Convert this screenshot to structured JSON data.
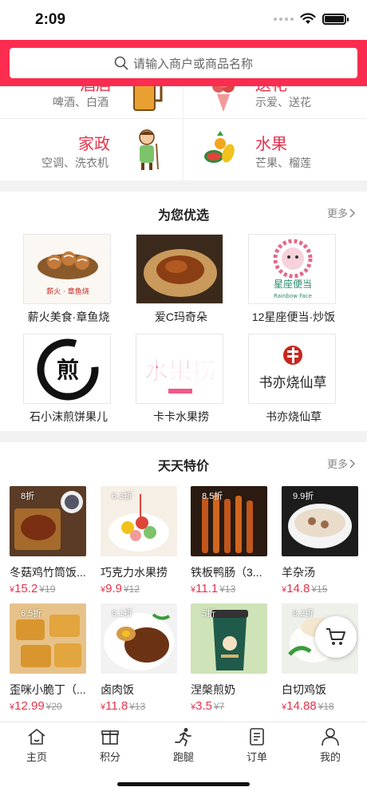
{
  "status_bar": {
    "time": "2:09"
  },
  "search": {
    "placeholder": "请输入商户或商品名称"
  },
  "categories": [
    {
      "title": "酒店",
      "subtitle": "啤酒、白酒"
    },
    {
      "title": "送花",
      "subtitle": "示爱、送花"
    },
    {
      "title": "家政",
      "subtitle": "空调、洗衣机"
    },
    {
      "title": "水果",
      "subtitle": "芒果、榴莲"
    }
  ],
  "recommended": {
    "title": "为您优选",
    "more": "更多",
    "shops": [
      {
        "name": "薪火美食·章鱼烧",
        "logo_text": "薪火 · 章鱼烧"
      },
      {
        "name": "爱C玛奇朵"
      },
      {
        "name": "12星座便当·炒饭",
        "logo_text": "星座便当",
        "logo_sub": "Rainbow Face"
      },
      {
        "name": "石小沫煎饼果儿",
        "logo_text": "煎"
      },
      {
        "name": "卡卡水果捞",
        "logo_text": "水果捞"
      },
      {
        "name": "书亦烧仙草",
        "logo_text": "书亦烧仙草"
      }
    ]
  },
  "daily_deals": {
    "title": "天天特价",
    "more": "更多",
    "items": [
      {
        "discount": "8折",
        "name": "冬菇鸡竹筒饭...",
        "price": "15.2",
        "original": "19"
      },
      {
        "discount": "6.3折",
        "name": "巧克力水果捞",
        "price": "9.9",
        "original": "12"
      },
      {
        "discount": "8.5折",
        "name": "铁板鸭肠（3...",
        "price": "11.1",
        "original": "13"
      },
      {
        "discount": "9.9折",
        "name": "羊杂汤",
        "price": "14.8",
        "original": "15"
      },
      {
        "discount": "6.5折",
        "name": "歪咪小脆丁（...",
        "price": "12.99",
        "original": "20"
      },
      {
        "discount": "9.1折",
        "name": "卤肉饭",
        "price": "11.8",
        "original": "13"
      },
      {
        "discount": "5折",
        "name": "涅槃煎奶",
        "price": "3.5",
        "original": "7"
      },
      {
        "discount": "8.2折",
        "name": "白切鸡饭",
        "price": "14.88",
        "original": "18"
      }
    ],
    "currency": "¥"
  },
  "tab_bar": [
    {
      "label": "主页",
      "icon": "home-icon"
    },
    {
      "label": "积分",
      "icon": "gift-icon"
    },
    {
      "label": "跑腿",
      "icon": "runner-icon"
    },
    {
      "label": "订单",
      "icon": "order-icon"
    },
    {
      "label": "我的",
      "icon": "user-icon"
    }
  ],
  "colors": {
    "brand": "#fb2c4f",
    "accent_text": "#e5334b"
  }
}
